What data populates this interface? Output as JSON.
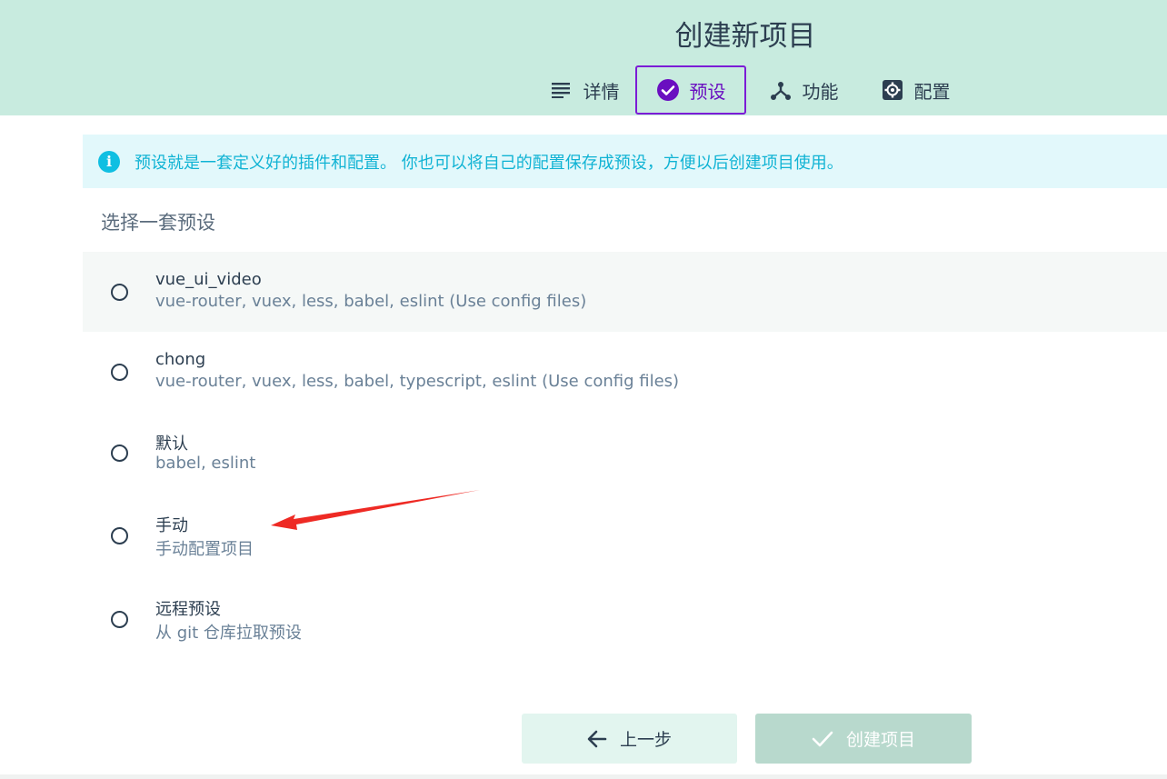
{
  "header": {
    "title": "创建新项目",
    "tabs": [
      {
        "label": "详情",
        "icon": "list-icon",
        "active": false
      },
      {
        "label": "预设",
        "icon": "check-circle-icon",
        "active": true
      },
      {
        "label": "功能",
        "icon": "fork-icon",
        "active": false
      },
      {
        "label": "配置",
        "icon": "gear-icon",
        "active": false
      }
    ]
  },
  "info": {
    "icon": "info-icon",
    "text": "预设就是一套定义好的插件和配置。 你也可以将自己的配置保存成预设，方便以后创建项目使用。"
  },
  "presets": {
    "title": "选择一套预设",
    "items": [
      {
        "name": "vue_ui_video",
        "description": "vue-router, vuex, less, babel, eslint (Use config files)"
      },
      {
        "name": "chong",
        "description": "vue-router, vuex, less, babel, typescript, eslint (Use config files)"
      },
      {
        "name": "默认",
        "description": "babel, eslint"
      },
      {
        "name": "手动",
        "description": "手动配置项目"
      },
      {
        "name": "远程预设",
        "description": "从 git 仓库拉取预设"
      }
    ]
  },
  "footer": {
    "prev_label": "上一步",
    "create_label": "创建项目"
  },
  "colors": {
    "header_bg": "#c8ebdf",
    "accent": "#7c1cd6",
    "info_bg": "#e2f8fb",
    "info_text": "#10b3d4",
    "annotation_arrow": "#ee2a24"
  }
}
